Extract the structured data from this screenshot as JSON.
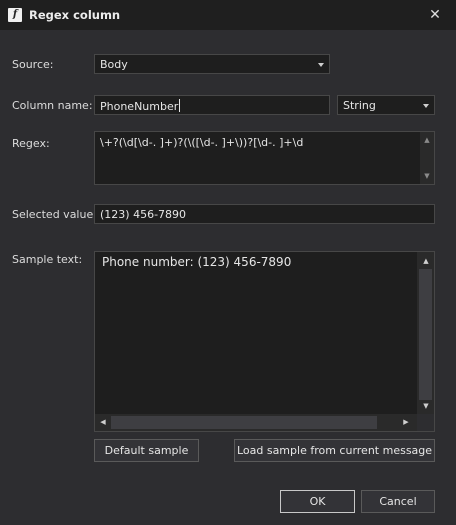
{
  "window": {
    "title": "Regex column",
    "icon": "function-icon",
    "close_glyph": "✕"
  },
  "source": {
    "label": "Source:",
    "value": "Body"
  },
  "column_name": {
    "label": "Column name:",
    "value": "PhoneNumber",
    "type_value": "String"
  },
  "regex": {
    "label": "Regex:",
    "value": "\\+?(\\d[\\d-. ]+)?(\\([\\d-. ]+\\))?[\\d-. ]+\\d"
  },
  "selected_value": {
    "label": "Selected value:",
    "value": "(123) 456-7890"
  },
  "sample_text": {
    "label": "Sample text:",
    "value": "Phone number: (123) 456-7890"
  },
  "buttons": {
    "default_sample": "Default sample",
    "load_sample": "Load sample from current message",
    "ok": "OK",
    "cancel": "Cancel"
  }
}
